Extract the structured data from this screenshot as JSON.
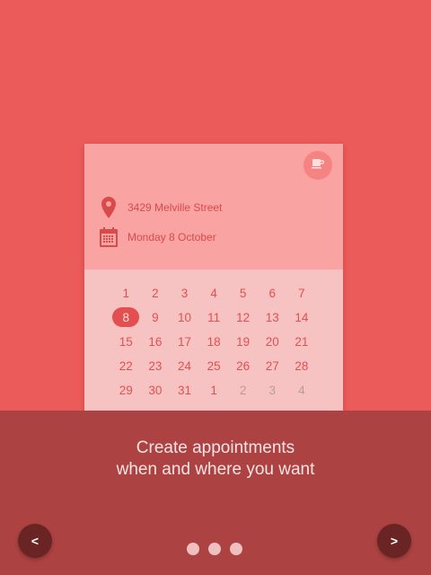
{
  "card": {
    "address": "3429 Melville Street",
    "date": "Monday 8 October",
    "icons": {
      "coffee": "coffee-cup-icon",
      "location": "location-pin-icon",
      "calendar": "calendar-icon"
    }
  },
  "calendar": {
    "selected": "8",
    "weeks": [
      [
        "1",
        "2",
        "3",
        "4",
        "5",
        "6",
        "7"
      ],
      [
        "8",
        "9",
        "10",
        "11",
        "12",
        "13",
        "14"
      ],
      [
        "15",
        "16",
        "17",
        "18",
        "19",
        "20",
        "21"
      ],
      [
        "22",
        "23",
        "24",
        "25",
        "26",
        "27",
        "28"
      ],
      [
        "29",
        "30",
        "31",
        "1",
        "2",
        "3",
        "4"
      ]
    ],
    "muted_in_last_row": [
      "2",
      "3",
      "4"
    ]
  },
  "onboarding": {
    "tagline_line1": "Create appointments",
    "tagline_line2": "when and where you want",
    "prev_label": "<",
    "next_label": ">",
    "page_count": 3
  },
  "colors": {
    "background": "#eb5b5a",
    "card": "#f9a3a2",
    "calendar": "#f7c3c2",
    "accent": "#e34f4f",
    "bottom_panel": "#ad4242",
    "nav_button": "#6b2424"
  }
}
